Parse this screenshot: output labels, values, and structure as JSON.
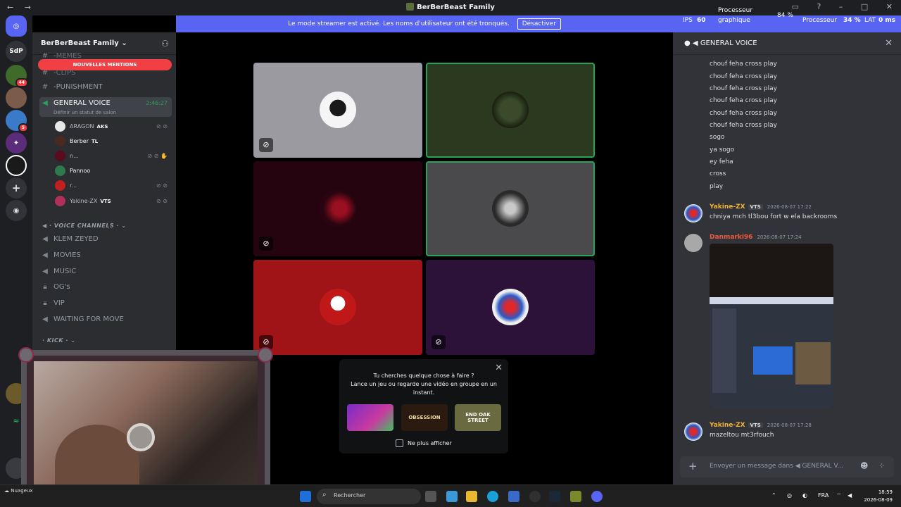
{
  "window": {
    "title": "BerBerBeast Family",
    "nav_back": "←",
    "nav_forward": "→"
  },
  "banner": {
    "text": "Le mode streamer est activé. Les noms d'utilisateur ont été tronqués.",
    "button": "Désactiver"
  },
  "overlay": {
    "processeur_label": "Processeur",
    "graphique_label": "graphique",
    "graphique_value": "84 %",
    "ips_label": "IPS",
    "ips_value": "60",
    "cpu_label": "Processeur",
    "cpu_value": "34 %",
    "lat_label": "LAT",
    "lat_value": "0 ms"
  },
  "rail": {
    "sdp": "SdP",
    "badge1": "44",
    "badge2": "5"
  },
  "guild": {
    "name": "BerBerBeast Family",
    "mentions_pill": "NOUVELLES MENTIONS"
  },
  "channels": {
    "memes": "-MEMES",
    "clips": "-CLIPS",
    "punishment": "-PUNISHMENT",
    "general_voice": "GENERAL VOICE",
    "status_placeholder": "Définir un statut de salon",
    "timer": "2:46:27",
    "voice_category": "VOICE CHANNELS",
    "klem": "KLEM ZEYED",
    "movies": "MOVIES",
    "music": "MUSIC",
    "ogs": "OG's",
    "vip": "VIP",
    "waiting": "WAITING FOR MOVE",
    "kick_category": "KICK"
  },
  "voice_users": [
    {
      "name": "ARAGON",
      "tag": "AKS"
    },
    {
      "name": "Berber",
      "tag": "TL"
    },
    {
      "name": "n...",
      "tag": ""
    },
    {
      "name": "Pannoo",
      "tag": ""
    },
    {
      "name": "r...",
      "tag": ""
    },
    {
      "name": "Yakine-ZX",
      "tag": "VTS"
    }
  ],
  "tiles": [
    {
      "bg": "#9a9aa0",
      "speaking": false,
      "muted": true
    },
    {
      "bg": "#2b3a1f",
      "speaking": true,
      "muted": false
    },
    {
      "bg": "#250410",
      "speaking": false,
      "muted": true
    },
    {
      "bg": "#4a4a4c",
      "speaking": true,
      "muted": false
    },
    {
      "bg": "#a01418",
      "speaking": false,
      "muted": true
    },
    {
      "bg": "#2c1238",
      "speaking": false,
      "muted": true
    }
  ],
  "activity": {
    "line1": "Tu cherches quelque chose à faire ?",
    "line2": "Lance un jeu ou regarde une vidéo en groupe en un instant.",
    "game2": "OBSESSION",
    "game3": "END OAK STREET",
    "checkbox": "Ne plus afficher"
  },
  "chat": {
    "title": "GENERAL VOICE",
    "lines": [
      "chouf feha cross play",
      "chouf feha cross play",
      "chouf feha cross play",
      "chouf feha cross play",
      "chouf feha cross play",
      "chouf feha cross play",
      "sogo",
      "ya sogo",
      "ey feha",
      "cross",
      "play"
    ],
    "msg1_author": "Yakine-ZX",
    "msg1_tag": "VTS",
    "msg1_time": "2026-08-07 17:22",
    "msg1_text": "chniya mch tl3bou fort w ela backrooms",
    "msg2_author": "Danmarki96",
    "msg2_time": "2026-08-07 17:24",
    "msg3_author": "Yakine-ZX",
    "msg3_tag": "VTS",
    "msg3_time": "2026-08-07 17:28",
    "msg3_text": "mazeltou mt3rfouch",
    "composer_placeholder": "Envoyer un message dans",
    "composer_channel": "GENERAL V..."
  },
  "taskbar": {
    "search": "Rechercher",
    "lang": "FRA",
    "time": "18:59",
    "date": "2026-08-09",
    "weather": "Nuageux"
  },
  "colors": {
    "blurple": "#5865f2",
    "speaking_green": "#23a55a",
    "mentions_red": "#f23f43"
  }
}
